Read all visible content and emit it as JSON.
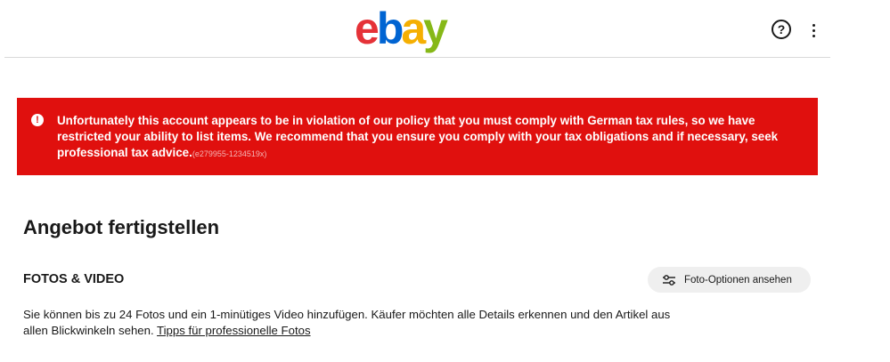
{
  "header": {
    "logo_letters": [
      {
        "char": "e",
        "color": "#e53238"
      },
      {
        "char": "b",
        "color": "#0064d2"
      },
      {
        "char": "a",
        "color": "#f5af02"
      },
      {
        "char": "y",
        "color": "#86b817"
      }
    ],
    "help_icon": "help-circle-icon",
    "more_icon": "more-vertical-icon"
  },
  "alert": {
    "message": "Unfortunately this account appears to be in violation of our policy that you must comply with German tax rules, so we have restricted your ability to list items. We recommend that you ensure you comply with your tax obligations and if necessary, seek professional tax advice.",
    "code": "(e279955-1234519x)",
    "icon": "alert-icon",
    "background": "#e0100e"
  },
  "page": {
    "title": "Angebot fertigstellen"
  },
  "photos_section": {
    "title": "FOTOS & VIDEO",
    "options_button": "Foto-Optionen ansehen",
    "options_icon": "sliders-icon",
    "description": "Sie können bis zu 24 Fotos und ein 1-minütiges Video hinzufügen. Käufer möchten alle Details erkennen und den Artikel aus allen Blickwinkeln sehen. ",
    "tips_link": "Tipps für professionelle Fotos"
  }
}
